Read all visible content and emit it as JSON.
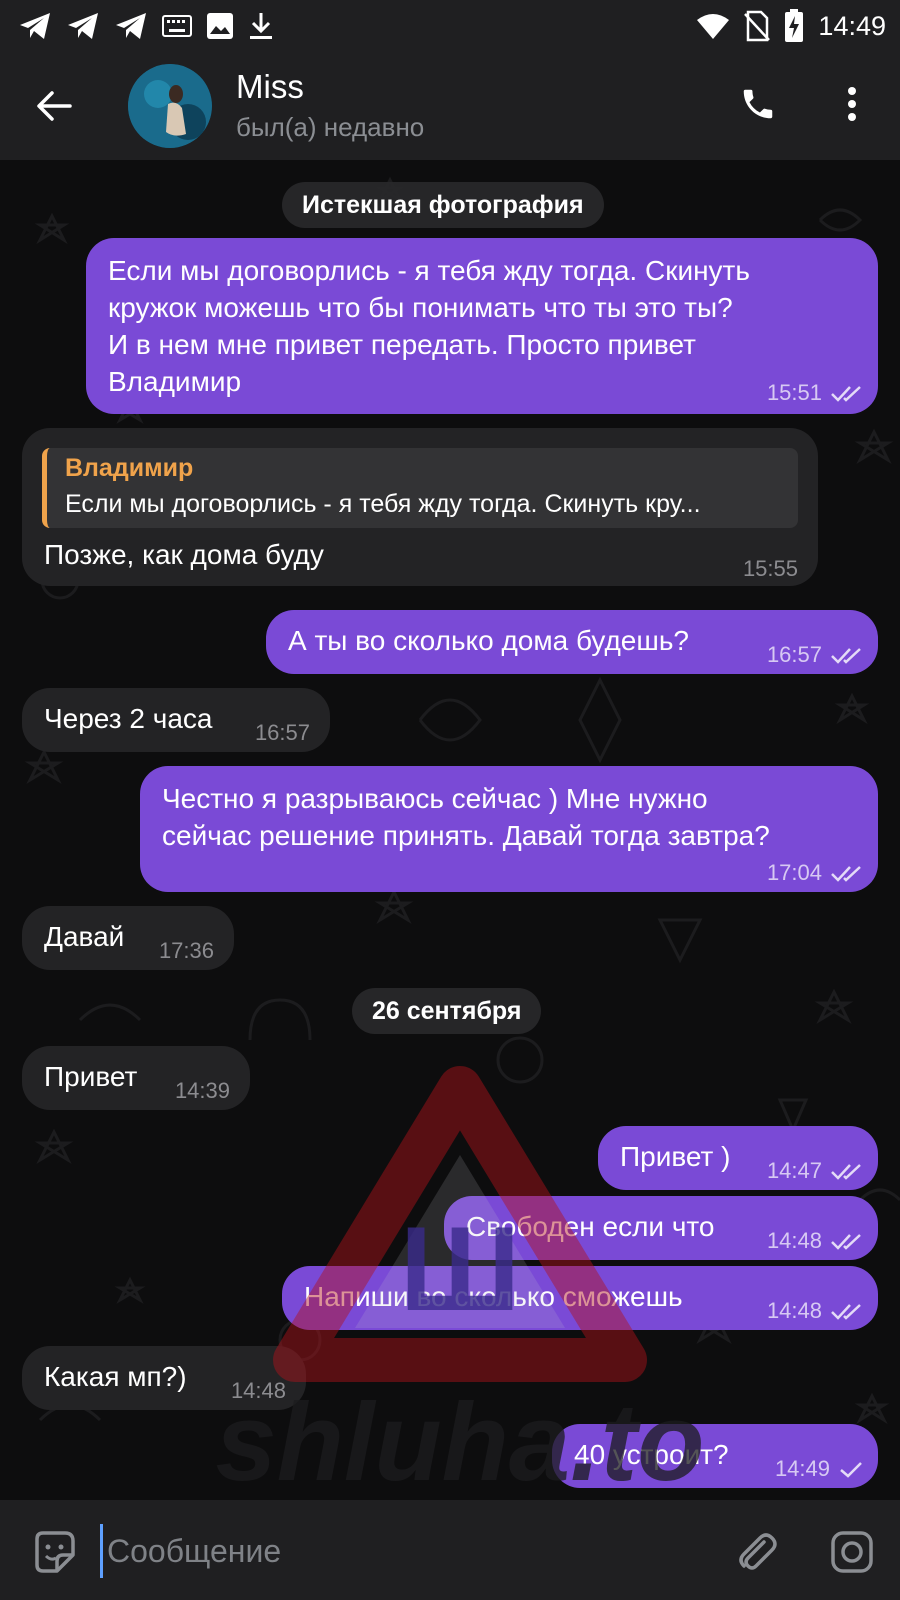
{
  "status_bar": {
    "time": "14:49",
    "left_icons": [
      "telegram-icon",
      "telegram-icon",
      "telegram-icon",
      "keyboard-icon",
      "image-icon",
      "download-icon"
    ],
    "right_icons": [
      "wifi-icon",
      "no-sim-icon",
      "battery-charging-icon"
    ]
  },
  "header": {
    "contact_name": "Miss",
    "contact_status": "был(а) недавно"
  },
  "chat": {
    "service_label_top": "Истекшая фотография",
    "date_divider": "26 сентября",
    "messages": [
      {
        "dir": "out",
        "text": "Если мы договорлись - я тебя жду тогда. Скинуть\nкружок можешь что бы понимать что ты это ты?\nИ в нем мне привет передать. Просто привет\nВладимир",
        "time": "15:51",
        "status": "read"
      },
      {
        "dir": "in",
        "reply_to_name": "Владимир",
        "reply_to_text": "Если мы договорлись - я тебя жду тогда. Скинуть кру...",
        "text": "Позже, как дома буду",
        "time": "15:55"
      },
      {
        "dir": "out",
        "text": "А ты во сколько дома будешь?",
        "time": "16:57",
        "status": "read"
      },
      {
        "dir": "in",
        "text": "Через 2 часа",
        "time": "16:57"
      },
      {
        "dir": "out",
        "text": "Честно я разрываюсь сейчас ) Мне нужно\nсейчас решение принять. Давай тогда завтра?",
        "time": "17:04",
        "status": "read"
      },
      {
        "dir": "in",
        "text": "Давай",
        "time": "17:36"
      },
      {
        "dir": "in",
        "text": "Привет",
        "time": "14:39"
      },
      {
        "dir": "out",
        "text": "Привет )",
        "time": "14:47",
        "status": "read"
      },
      {
        "dir": "out",
        "text": "Свободен если что",
        "time": "14:48",
        "status": "read"
      },
      {
        "dir": "out",
        "text": "Напиши во сколько сможешь",
        "time": "14:48",
        "status": "read"
      },
      {
        "dir": "in",
        "text": "Какая мп?)",
        "time": "14:48"
      },
      {
        "dir": "out",
        "text": "40 устроит?",
        "time": "14:49",
        "status": "sent"
      }
    ]
  },
  "watermark": {
    "text": "shluha.to",
    "letter": "Ш",
    "color": "#b3121b"
  },
  "input": {
    "placeholder": "Сообщение"
  },
  "colors": {
    "outgoing_bubble": "#7a4ad6",
    "incoming_bubble": "#232325",
    "reply_accent": "#f0a34b",
    "bar_background": "#1f1f21"
  }
}
